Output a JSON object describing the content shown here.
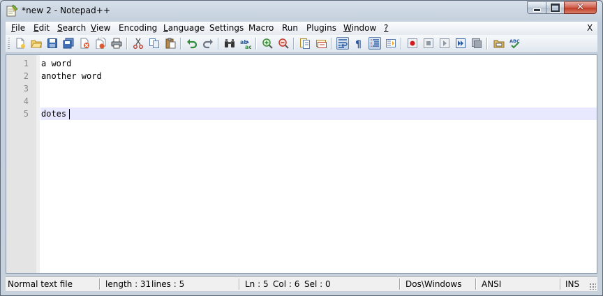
{
  "window": {
    "title": "*new  2 - Notepad++",
    "caption_buttons": {
      "minimize_icon": "minimize-icon",
      "maximize_icon": "maximize-icon",
      "close_label": "✕"
    }
  },
  "menubar": {
    "items": [
      {
        "mn": "F",
        "rest": "ile"
      },
      {
        "mn": "E",
        "rest": "dit"
      },
      {
        "mn": "S",
        "rest": "earch"
      },
      {
        "mn": "V",
        "rest": "iew"
      },
      {
        "mn": "",
        "rest": "Encoding"
      },
      {
        "mn": "L",
        "rest": "anguage"
      },
      {
        "mn": "",
        "rest": "Settings"
      },
      {
        "mn": "",
        "rest": "Macro"
      },
      {
        "mn": "",
        "rest": "Run"
      },
      {
        "mn": "",
        "rest": "Plugins"
      },
      {
        "mn": "W",
        "rest": "indow"
      },
      {
        "mn": "?",
        "rest": ""
      }
    ],
    "close_doc_label": "X"
  },
  "toolbar": {
    "buttons": [
      "new-file-icon",
      "open-file-icon",
      "save-icon",
      "save-all-icon",
      "close-icon",
      "close-all-icon",
      "print-icon",
      "cut-icon",
      "copy-icon",
      "paste-icon",
      "undo-icon",
      "redo-icon",
      "find-icon",
      "replace-icon",
      "zoom-in-icon",
      "zoom-out-icon",
      "sync-vertical-icon",
      "sync-horizontal-icon",
      "word-wrap-icon",
      "show-all-characters-icon",
      "indent-guide-icon",
      "document-map-icon",
      "record-macro-icon",
      "stop-record-icon",
      "play-macro-icon",
      "run-macro-multiple-icon",
      "save-macro-icon",
      "folder-as-workspace-icon",
      "spell-check-icon"
    ]
  },
  "editor": {
    "lines": [
      {
        "number": "1",
        "text": "a word"
      },
      {
        "number": "2",
        "text": "another word"
      },
      {
        "number": "3",
        "text": ""
      },
      {
        "number": "4",
        "text": ""
      },
      {
        "number": "5",
        "text": "dotes"
      }
    ],
    "current_line": 5,
    "current_line_color": "#e8e8ff"
  },
  "statusbar": {
    "file_type": "Normal text file",
    "length": "length : 31",
    "lines": "lines : 5",
    "ln": "Ln : 5",
    "col": "Col : 6",
    "sel": "Sel : 0",
    "eol": "Dos\\Windows",
    "encoding": "ANSI",
    "mode": "INS"
  }
}
